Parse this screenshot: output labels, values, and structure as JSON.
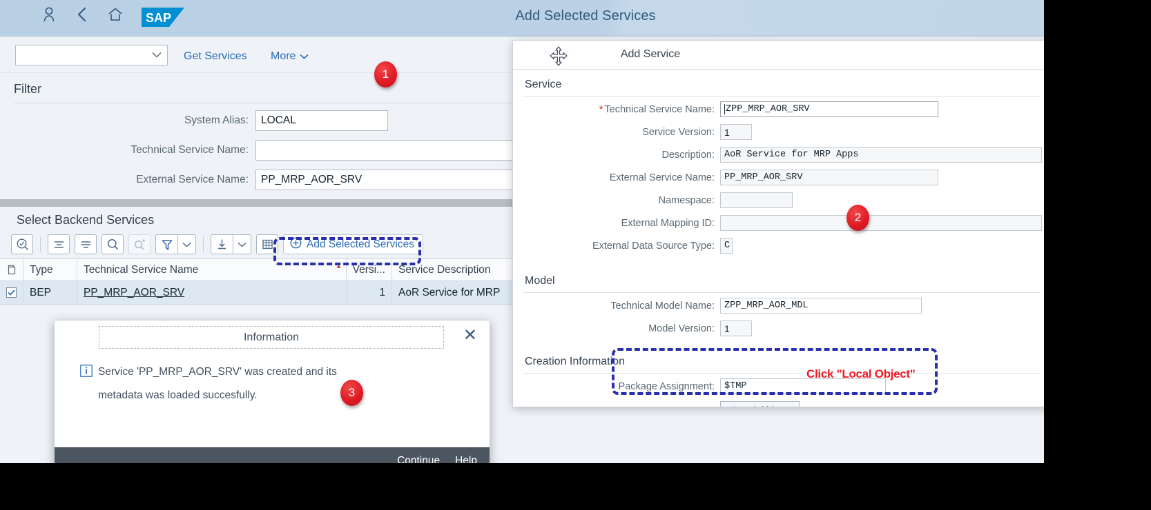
{
  "header": {
    "title": "Add Selected Services",
    "logo_text": "SAP",
    "icons": [
      "user-icon",
      "back-icon",
      "home-icon"
    ]
  },
  "action_bar": {
    "combo_value": "",
    "get_services_label": "Get Services",
    "more_label": "More"
  },
  "filter": {
    "section_title": "Filter",
    "fields": [
      {
        "label": "System Alias:",
        "value": "LOCAL"
      },
      {
        "label": "Technical Service Name:",
        "value": ""
      },
      {
        "label": "External Service Name:",
        "value": "PP_MRP_AOR_SRV"
      }
    ]
  },
  "table_section": {
    "title": "Select Backend Services",
    "toolbar": {
      "add_selected_label": "Add Selected Services",
      "icons": [
        "search-with-check-icon",
        "group-icon",
        "sort-icon",
        "search-icon",
        "search-plus-icon",
        "filter-icon",
        "filter-dropdown-icon",
        "export-icon",
        "export-dropdown-icon",
        "table-settings-icon"
      ]
    },
    "columns": [
      "",
      "Type",
      "Technical Service Name",
      "Versi...",
      "Service Description"
    ],
    "rows": [
      {
        "selected": true,
        "type": "BEP",
        "technical_service_name": "PP_MRP_AOR_SRV",
        "version": "1",
        "description": "AoR Service for MRP"
      }
    ]
  },
  "add_service_dialog": {
    "title": "Add Service",
    "sections": {
      "service": {
        "title": "Service",
        "fields": [
          {
            "label": "Technical Service Name:",
            "value": "ZPP_MRP_AOR_SRV",
            "required": true
          },
          {
            "label": "Service Version:",
            "value": "1",
            "required": false
          },
          {
            "label": "Description:",
            "value": "AoR Service for MRP Apps",
            "required": false
          },
          {
            "label": "External Service Name:",
            "value": "PP_MRP_AOR_SRV",
            "required": false
          },
          {
            "label": "Namespace:",
            "value": "",
            "required": false
          },
          {
            "label": "External Mapping ID:",
            "value": "",
            "required": false
          },
          {
            "label": "External Data Source Type:",
            "value": "C",
            "required": false
          }
        ]
      },
      "model": {
        "title": "Model",
        "fields": [
          {
            "label": "Technical Model Name:",
            "value": "ZPP_MRP_AOR_MDL"
          },
          {
            "label": "Model Version:",
            "value": "1"
          }
        ]
      },
      "creation": {
        "title": "Creation Information",
        "package_label": "Package Assignment:",
        "package_value": "$TMP",
        "local_object_label": "Local Object"
      }
    }
  },
  "information_dialog": {
    "title": "Information",
    "message_line1": "Service 'PP_MRP_AOR_SRV' was created and its",
    "message_line2": "metadata was loaded succesfully.",
    "close_label": "✕",
    "continue_label": "Continue",
    "help_label": "Help"
  },
  "annotations": {
    "badges": [
      "1",
      "2",
      "3"
    ],
    "red_note": "Click \"Local Object\"",
    "highlight_color": "#2a2fae",
    "badge_color": "#e01b24",
    "note_color": "#ef1b24"
  }
}
